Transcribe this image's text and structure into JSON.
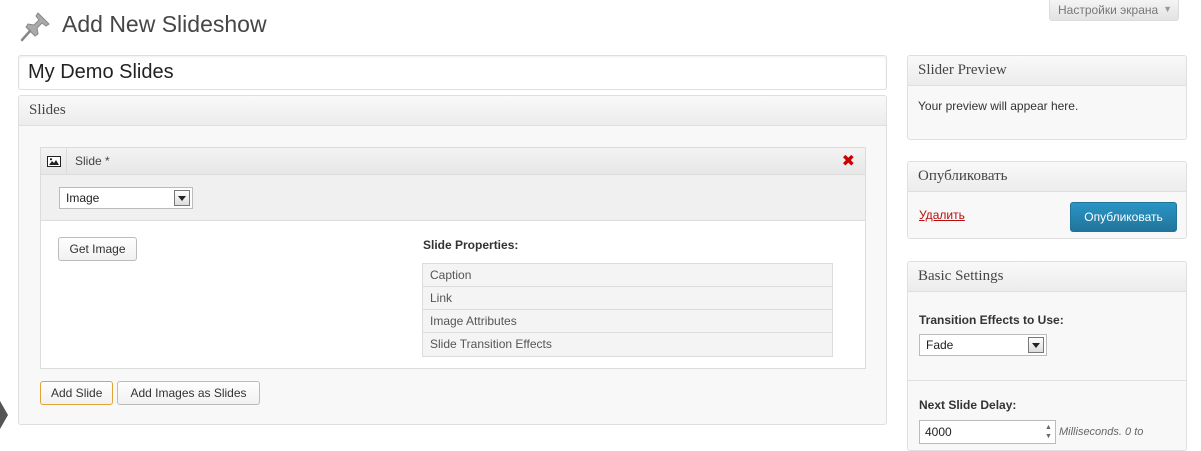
{
  "header": {
    "title": "Add New Slideshow",
    "icon": "pushpin-icon",
    "screen_options": "Настройки экрана"
  },
  "title_field": {
    "value": "My Demo Slides"
  },
  "slides_box": {
    "title": "Slides",
    "slide": {
      "label": "Slide *",
      "type_select": {
        "value": "Image"
      },
      "get_image_label": "Get Image",
      "props_title": "Slide Properties:",
      "props": [
        "Caption",
        "Link",
        "Image Attributes",
        "Slide Transition Effects"
      ]
    },
    "add_slide_label": "Add Slide",
    "add_images_label": "Add Images as Slides"
  },
  "preview_box": {
    "title": "Slider Preview",
    "text": "Your preview will appear here."
  },
  "publish_box": {
    "title": "Опубликовать",
    "delete_label": "Удалить",
    "publish_label": "Опубликовать",
    "accent": "#21759b"
  },
  "basic_settings": {
    "title": "Basic Settings",
    "transition_label": "Transition Effects to Use:",
    "transition_value": "Fade",
    "delay_label": "Next Slide Delay:",
    "delay_value": "4000",
    "delay_note": "Milliseconds. 0 to"
  }
}
